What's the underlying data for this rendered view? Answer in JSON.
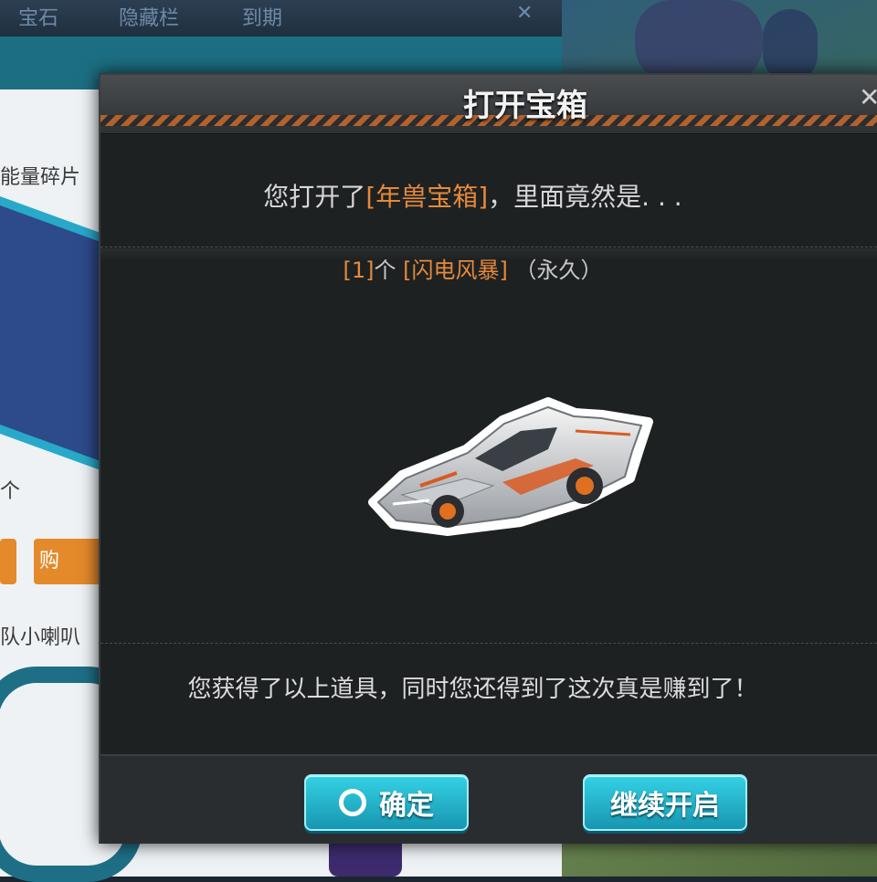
{
  "background": {
    "tabs": [
      "宝石",
      "隐藏栏",
      "到期"
    ],
    "close_glyph": "✕",
    "text_energy_fragments": "能量碎片",
    "text_fragment2": "个",
    "button_label": "购",
    "text_fragment3": "队小喇叭"
  },
  "dialog": {
    "title": "打开宝箱",
    "close_glyph": "✕",
    "message_prefix": "您打开了",
    "message_chest": "[年兽宝箱]",
    "message_suffix": "，里面竟然是. . .",
    "reward_count": "[1]",
    "reward_unit": "个",
    "reward_item": "[闪电风暴]",
    "reward_duration": "（永久）",
    "reward_icon": "race-car-icon",
    "bottom_message": "您获得了以上道具，同时您还得到了这次真是赚到了！",
    "buttons": {
      "confirm": "确定",
      "continue": "继续开启"
    }
  },
  "colors": {
    "highlight": "#e5893b",
    "button": "#1fb3cc",
    "dialog_bg": "#1e2122"
  }
}
